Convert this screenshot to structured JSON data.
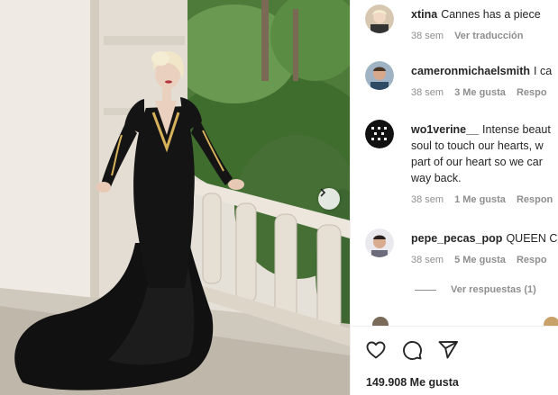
{
  "post": {
    "image_alt": "",
    "carousel_next_icon": "chevron-right-icon"
  },
  "comments": [
    {
      "username": "xtina",
      "text": "Cannes has a piece",
      "age": "38 sem",
      "likes": "",
      "reply": "",
      "extra": "Ver traducción"
    },
    {
      "username": "cameronmichaelsmith",
      "text": "I ca",
      "age": "38 sem",
      "likes": "3 Me gusta",
      "reply": "Respo",
      "extra": ""
    },
    {
      "username": "wo1verine__",
      "text": "Intense beaut",
      "line2": "soul to touch our hearts, w",
      "line3": "part of our heart so we car",
      "line4": "way back.",
      "age": "38 sem",
      "likes": "1 Me gusta",
      "reply": "Respon",
      "extra": ""
    },
    {
      "username": "pepe_pecas_pop",
      "text": "QUEEN C",
      "age": "38 sem",
      "likes": "5 Me gusta",
      "reply": "Respo",
      "extra": ""
    }
  ],
  "view_replies": "Ver respuestas (1)",
  "actions": {
    "like_icon": "heart-icon",
    "comment_icon": "comment-icon",
    "share_icon": "share-icon"
  },
  "likes_count": "149.908",
  "likes_label": "Me gusta",
  "colors": {
    "text": "#262626",
    "muted": "#8e8e8e",
    "border": "#efefef"
  }
}
